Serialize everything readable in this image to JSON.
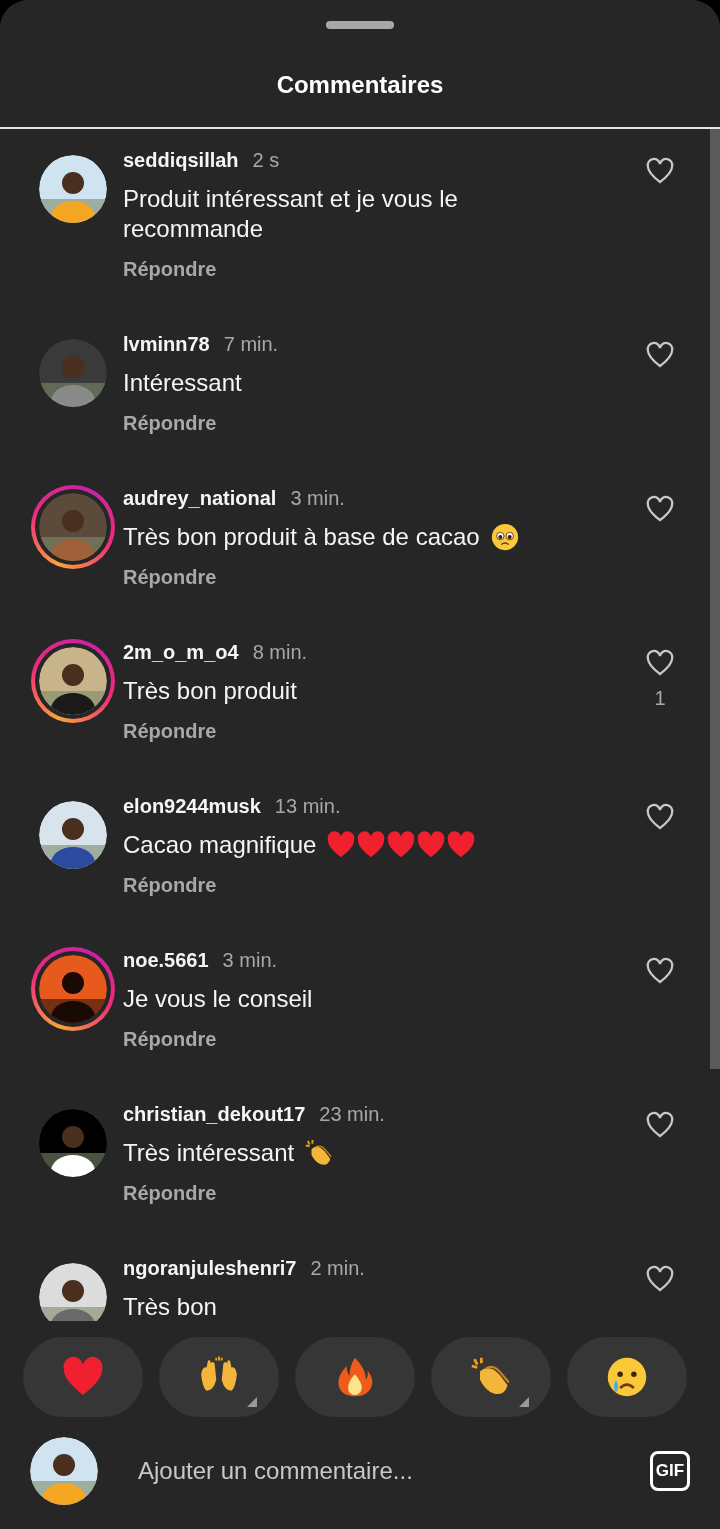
{
  "sheet": {
    "title": "Commentaires"
  },
  "comments": [
    {
      "username": "seddiqsillah",
      "time": "2 s",
      "text": "Produit intéressant et je vous le recommande",
      "reply": "Répondre",
      "story_ring": false,
      "liked": false
    },
    {
      "username": "lvminn78",
      "time": "7 min.",
      "text": "Intéressant",
      "reply": "Répondre",
      "story_ring": false,
      "liked": false
    },
    {
      "username": "audrey_national",
      "time": "3 min.",
      "text": "Très bon produit à base de cacao",
      "emojis": [
        {
          "kind": "pleading"
        }
      ],
      "reply": "Répondre",
      "story_ring": true,
      "liked": false
    },
    {
      "username": "2m_o_m_o4",
      "time": "8 min.",
      "text": "Très bon produit",
      "reply": "Répondre",
      "story_ring": true,
      "liked": false,
      "likes": "1"
    },
    {
      "username": "elon9244musk",
      "time": "13 min.",
      "text": "Cacao magnifique",
      "emojis": [
        {
          "kind": "heart"
        },
        {
          "kind": "heart"
        },
        {
          "kind": "heart"
        },
        {
          "kind": "heart"
        },
        {
          "kind": "heart"
        }
      ],
      "reply": "Répondre",
      "story_ring": false,
      "liked": false
    },
    {
      "username": "noe.5661",
      "time": "3 min.",
      "text": "Je vous le conseil",
      "reply": "Répondre",
      "story_ring": true,
      "liked": false
    },
    {
      "username": "christian_dekout17",
      "time": "23 min.",
      "text": "Très intéressant",
      "emojis": [
        {
          "kind": "clap"
        }
      ],
      "reply": "Répondre",
      "story_ring": false,
      "liked": false
    },
    {
      "username": "ngoranjuleshenri7",
      "time": "2 min.",
      "text": "Très bon",
      "story_ring": false,
      "liked": false
    }
  ],
  "reactions": [
    {
      "kind": "heart",
      "has_variants": false
    },
    {
      "kind": "raised-hands",
      "has_variants": true
    },
    {
      "kind": "fire",
      "has_variants": false
    },
    {
      "kind": "clap",
      "has_variants": true
    },
    {
      "kind": "crying",
      "has_variants": false
    }
  ],
  "composer": {
    "placeholder": "Ajouter un commentaire...",
    "gif": "GIF"
  }
}
